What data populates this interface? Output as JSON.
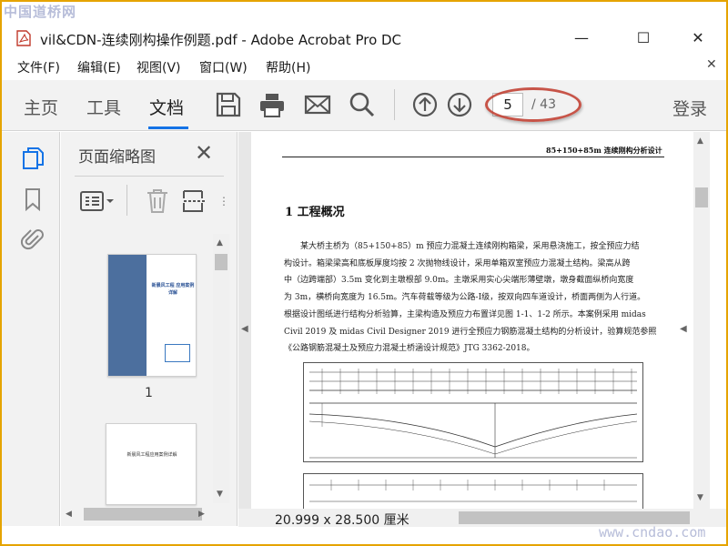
{
  "watermark": {
    "top": "中国道桥网",
    "bottom": "www.cndao.com"
  },
  "window": {
    "title": "vil&CDN-连续刚构操作例题.pdf - Adobe Acrobat Pro DC",
    "minimize": "—",
    "maximize": "☐",
    "close": "✕"
  },
  "menu": {
    "items": [
      "文件(F)",
      "编辑(E)",
      "视图(V)",
      "窗口(W)",
      "帮助(H)"
    ],
    "close": "✕"
  },
  "toolbar": {
    "tabs": [
      "主页",
      "工具",
      "文档"
    ],
    "active_tab": "文档",
    "icons": [
      "save-icon",
      "print-icon",
      "email-icon",
      "search-icon",
      "page-up-icon",
      "page-down-icon"
    ],
    "current_page": "5",
    "total_pages": "/ 43",
    "login": "登录",
    "accent_color": "#1473e6"
  },
  "sidebar": {
    "rail_icons": [
      "page-thumbnails-icon",
      "bookmark-icon",
      "attachment-icon"
    ],
    "panel_title": "页面缩略图",
    "close": "✕",
    "thumbnails": [
      {
        "label": "1",
        "title": "新晨风工程\n应用案例详解"
      },
      {
        "label": "",
        "title": "新晨风工程应用案例详解"
      }
    ]
  },
  "document": {
    "header": "85+150+85m 连续刚构分析设计",
    "section_title": "1 工程概况",
    "body_lines": [
      "　　某大桥主桥为（85+150+85）m 预应力混凝土连续刚构箱梁，采用悬浇施工，按全预应力结",
      "构设计。箱梁梁高和底板厚度均按 2 次抛物线设计，采用单箱双室预应力混凝土结构。梁高从跨",
      "中（边跨端部）3.5m 变化到主墩根部 9.0m。主墩采用实心尖端形薄壁墩，墩身截面纵桥向宽度",
      "为 3m，横桥向宽度为 16.5m。汽车荷载等级为公路-I级，按双向四车道设计，桥面两侧为人行道。",
      "根据设计图纸进行结构分析验算，主梁构造及预应力布置详见图 1-1、1-2 所示。本案例采用 midas",
      "Civil 2019 及 midas Civil Designer 2019 进行全预应力钢筋混凝土结构的分析设计，验算规范参照",
      "《公路钢筋混凝土及预应力混凝土桥涵设计规范》JTG 3362-2018。"
    ],
    "page_size": "20.999 x 28.500 厘米"
  }
}
